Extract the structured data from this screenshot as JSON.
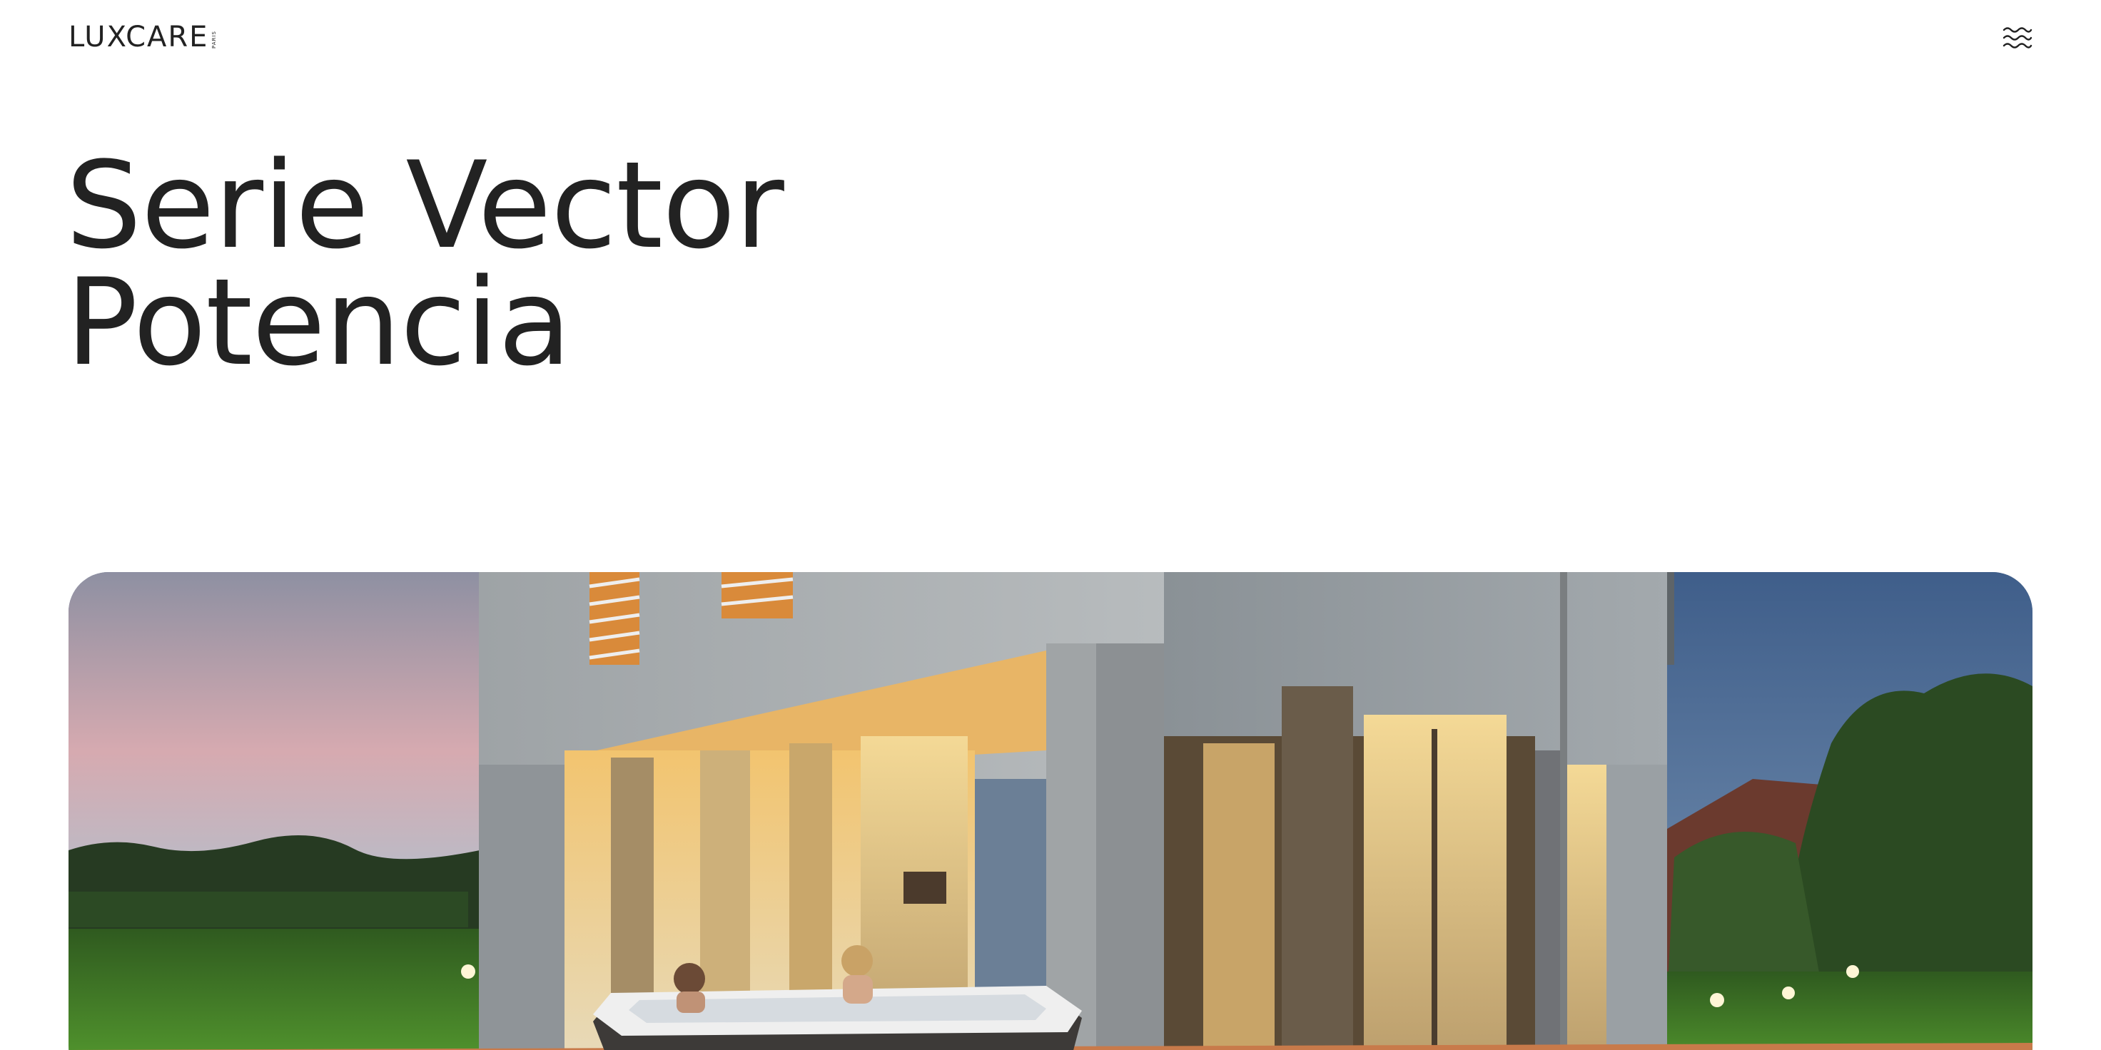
{
  "header": {
    "logo_text": "LUXCARE",
    "logo_subtext": "PARIS",
    "menu_icon": "menu-waves-icon"
  },
  "hero": {
    "title_line1": "Serie Vector",
    "title_line2": "Potencia"
  },
  "colors": {
    "text": "#222222",
    "background": "#ffffff"
  }
}
